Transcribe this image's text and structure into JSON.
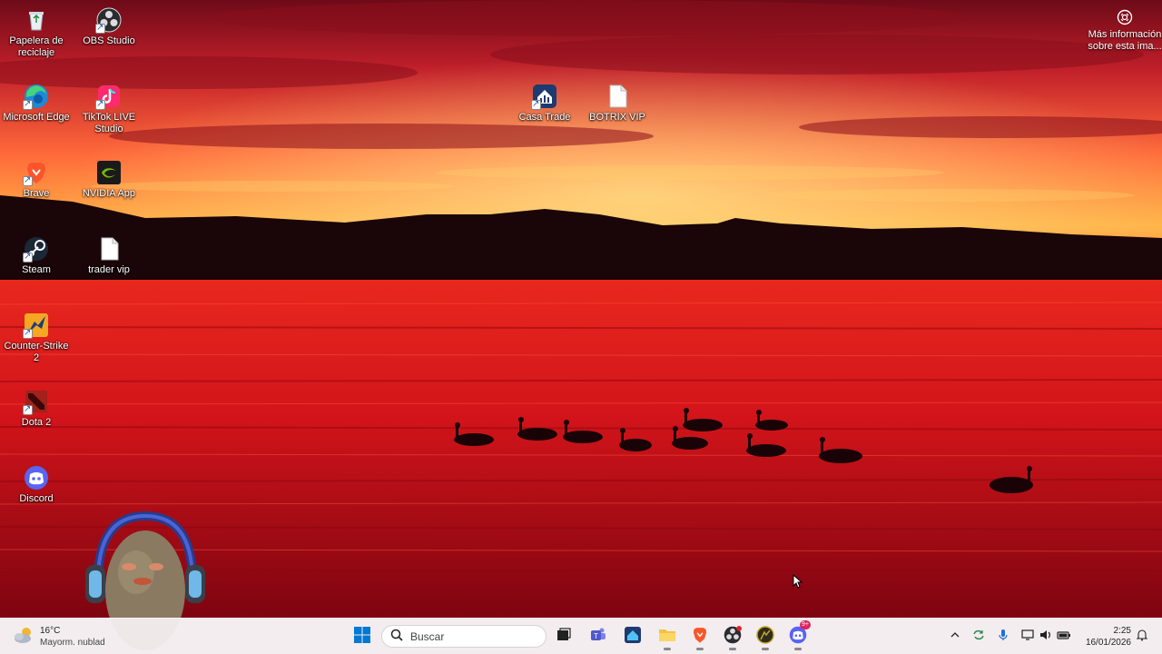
{
  "desktop": {
    "icons": [
      {
        "label": "Papelera de reciclaje",
        "icon": "recycle-bin-icon"
      },
      {
        "label": "OBS Studio",
        "icon": "obs-icon"
      },
      {
        "label": "Microsoft Edge",
        "icon": "edge-icon"
      },
      {
        "label": "TikTok LIVE Studio",
        "icon": "tiktok-live-icon"
      },
      {
        "label": "Brave",
        "icon": "brave-icon"
      },
      {
        "label": "NVIDIA App",
        "icon": "nvidia-icon"
      },
      {
        "label": "Steam",
        "icon": "steam-icon"
      },
      {
        "label": "trader vip",
        "icon": "text-file-icon"
      },
      {
        "label": "Counter-Strike 2",
        "icon": "cs2-icon"
      },
      {
        "label": "Dota 2",
        "icon": "dota2-icon"
      },
      {
        "label": "Discord",
        "icon": "discord-icon"
      },
      {
        "label": "Casa Trade",
        "icon": "casa-trade-icon"
      },
      {
        "label": "BOTRIX VIP",
        "icon": "text-file-icon"
      }
    ],
    "info_button": {
      "label": "Más información sobre esta ima...",
      "icon": "camera-info-icon"
    }
  },
  "taskbar": {
    "weather": {
      "temp": "16°C",
      "condition": "Mayorm. nublad",
      "icon": "partly-cloudy-icon"
    },
    "start_icon": "windows-start-icon",
    "search": {
      "placeholder": "Buscar",
      "icon": "search-icon"
    },
    "pinned": [
      {
        "name": "task-view",
        "icon": "task-view-icon"
      },
      {
        "name": "teams",
        "icon": "teams-icon"
      },
      {
        "name": "casa-trade",
        "icon": "casa-trade-icon"
      },
      {
        "name": "file-explorer",
        "icon": "folder-icon"
      },
      {
        "name": "brave",
        "icon": "brave-icon"
      },
      {
        "name": "obs",
        "icon": "obs-icon"
      },
      {
        "name": "cs2",
        "icon": "cs2-icon"
      },
      {
        "name": "discord",
        "icon": "discord-icon",
        "badge": "9+"
      }
    ],
    "tray": [
      "chevron-up-icon",
      "sync-icon",
      "microphone-icon",
      "display-icon",
      "speaker-icon",
      "battery-icon"
    ],
    "clock": {
      "time": "2:25",
      "date": "16/01/2026"
    },
    "notification_icon": "notification-bell-icon"
  },
  "colors": {
    "accent": "#0078d4",
    "sky_top": "#7a0d1a",
    "sky_glow": "#ffb347",
    "water": "#d4141a"
  }
}
